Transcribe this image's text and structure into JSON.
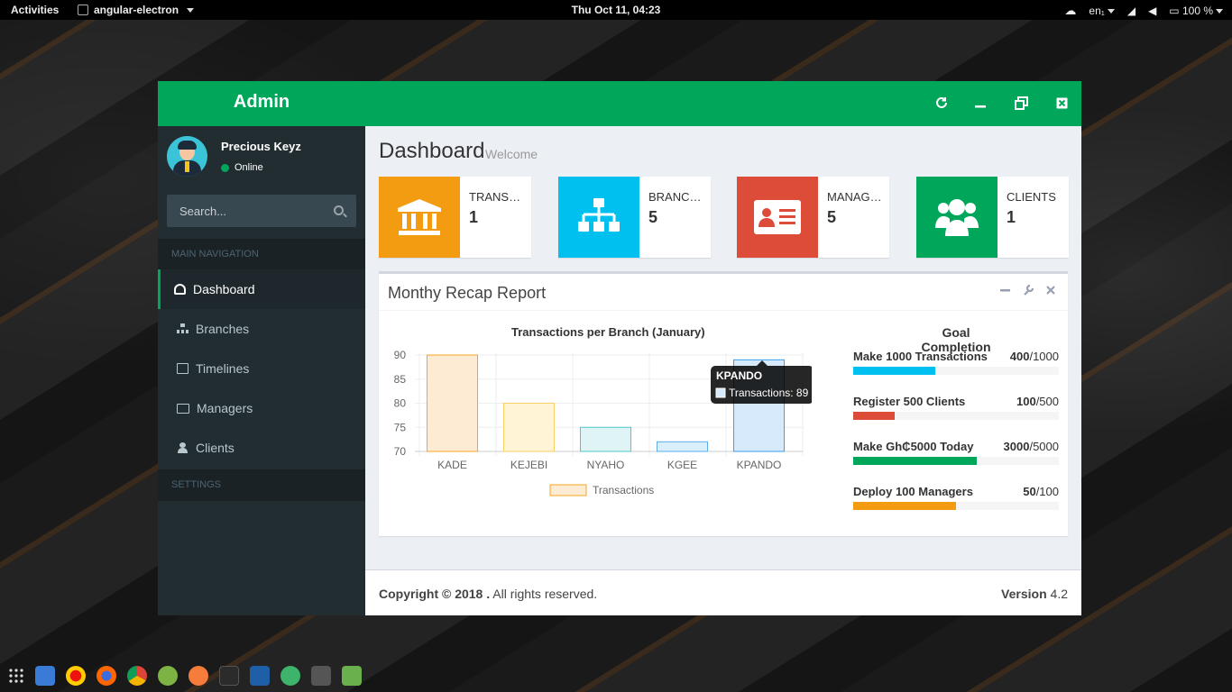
{
  "topbar": {
    "activities": "Activities",
    "app_name": "angular-electron",
    "clock": "Thu Oct 11, 04:23",
    "lang": "en₁",
    "battery": "100 %"
  },
  "sidebar": {
    "logo": "Admin",
    "user_name": "Precious Keyz",
    "user_status": "Online",
    "search_placeholder": "Search...",
    "main_nav_header": "MAIN NAVIGATION",
    "settings_header": "SETTINGS",
    "items": [
      {
        "label": "Dashboard",
        "icon": "dashboard-icon",
        "active": true
      },
      {
        "label": "Branches",
        "icon": "sitemap-icon"
      },
      {
        "label": "Timelines",
        "icon": "calendar-icon"
      },
      {
        "label": "Managers",
        "icon": "id-card-icon"
      },
      {
        "label": "Clients",
        "icon": "users-icon"
      }
    ]
  },
  "header": {
    "buttons": [
      "refresh-icon",
      "minimize-icon",
      "restore-icon",
      "close-icon"
    ]
  },
  "page": {
    "title": "Dashboard",
    "subtitle": "Welcome"
  },
  "info_boxes": [
    {
      "label": "TRANSACTIONS",
      "value": "1",
      "color": "#f39c12",
      "icon": "bank-icon"
    },
    {
      "label": "BRANCHES",
      "value": "5",
      "color": "#00c0ef",
      "icon": "sitemap-icon"
    },
    {
      "label": "MANAGERS",
      "value": "5",
      "color": "#dd4b39",
      "icon": "id-card-icon"
    },
    {
      "label": "CLIENTS",
      "value": "1",
      "color": "#00a65a",
      "icon": "users-icon"
    }
  ],
  "report": {
    "title": "Monthy Recap Report",
    "goal_title": "Goal Completion",
    "goals": [
      {
        "text": "Make 1000 Transactions",
        "current": "400",
        "total": "/1000",
        "fraction": 0.4,
        "color": "#00c0ef"
      },
      {
        "text": "Register 500 Clients",
        "current": "100",
        "total": "/500",
        "fraction": 0.2,
        "color": "#dd4b39"
      },
      {
        "text": "Make Gh₵5000 Today",
        "current": "3000",
        "total": "/5000",
        "fraction": 0.6,
        "color": "#00a65a"
      },
      {
        "text": "Deploy 100 Managers",
        "current": "50",
        "total": "/100",
        "fraction": 0.5,
        "color": "#f39c12"
      }
    ]
  },
  "chart_data": {
    "type": "bar",
    "title": "Transactions per Branch (January)",
    "categories": [
      "KADE",
      "KEJEBI",
      "NYAHO",
      "KGEE",
      "KPANDO"
    ],
    "series": [
      {
        "name": "Transactions",
        "values": [
          90,
          80,
          75,
          72,
          89
        ]
      }
    ],
    "colors": [
      {
        "fill": "#fdebd3",
        "stroke": "#f5a623"
      },
      {
        "fill": "#fff5d6",
        "stroke": "#fbd067"
      },
      {
        "fill": "#dff5f5",
        "stroke": "#4dc9c9"
      },
      {
        "fill": "#dbeefb",
        "stroke": "#5aaee5"
      },
      {
        "fill": "#d6eafc",
        "stroke": "#36a2eb"
      }
    ],
    "ylim": [
      70,
      90
    ],
    "yticks": [
      90,
      85,
      80,
      75,
      70
    ],
    "legend": "bottom",
    "grid": true,
    "tooltip": {
      "title": "KPANDO",
      "body": "Transactions: 89"
    }
  },
  "footer": {
    "copyright": "Copyright © 2018 .",
    "rights": " All rights reserved.",
    "version_label": "Version",
    "version": " 4.2"
  }
}
